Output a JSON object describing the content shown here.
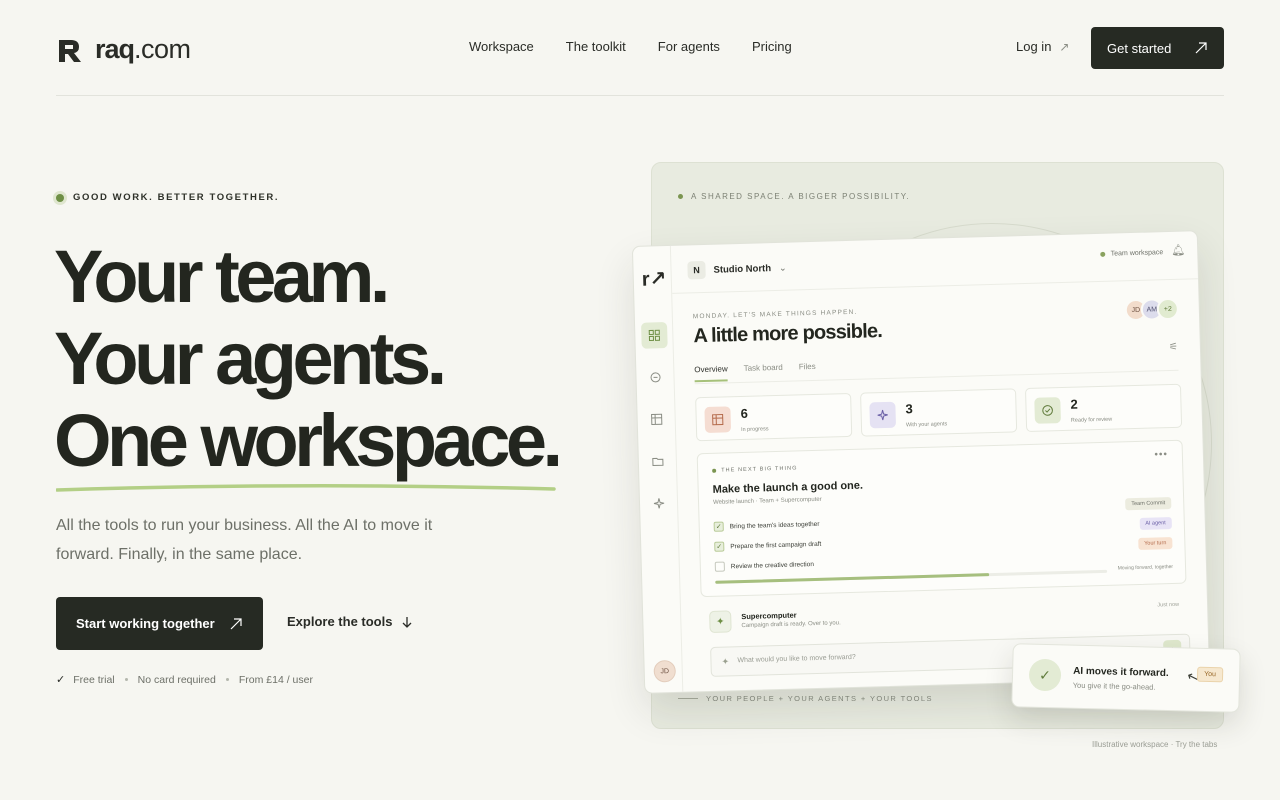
{
  "brand": {
    "name": "raq",
    "tld": ".com"
  },
  "nav": {
    "links": [
      "Workspace",
      "The toolkit",
      "For agents",
      "Pricing"
    ],
    "login": "Log in",
    "cta": "Get started"
  },
  "hero": {
    "eyebrow": "GOOD WORK. BETTER TOGETHER.",
    "headline": [
      "Your team.",
      "Your agents.",
      "One workspace."
    ],
    "subtext": "All the tools to run your business. All the AI to move it forward. Finally, in the same place.",
    "primary_cta": "Start working together",
    "secondary_cta": "Explore the tools",
    "perks": [
      "Free trial",
      "No card required",
      "From £14 / user"
    ]
  },
  "panel": {
    "eyebrow": "A SHARED SPACE. A BIGGER POSSIBILITY.",
    "footer": "YOUR PEOPLE + YOUR AGENTS + YOUR TOOLS",
    "caption": "Illustrative workspace · Try the tabs"
  },
  "app": {
    "logo": "r↗",
    "workspace_initial": "N",
    "workspace_name": "Studio North",
    "team_label": "Team workspace",
    "greeting": "MONDAY. LET'S MAKE THINGS HAPPEN.",
    "title": "A little more possible.",
    "avatars": [
      "JD",
      "AM",
      "+2"
    ],
    "tabs": [
      "Overview",
      "Task board",
      "Files"
    ],
    "stats": [
      {
        "value": "6",
        "label": "In progress",
        "icon": "table-icon"
      },
      {
        "value": "3",
        "label": "With your agents",
        "icon": "sparkle-icon"
      },
      {
        "value": "2",
        "label": "Ready for review",
        "icon": "check-circle-icon"
      }
    ],
    "card": {
      "eyebrow": "THE NEXT BIG THING",
      "title": "Make the launch a good one.",
      "meta": "Website launch   ·   Team + Supercomputer",
      "tasks": [
        {
          "label": "Bring the team's ideas together",
          "done": true,
          "tag": "Team Commit"
        },
        {
          "label": "Prepare the first campaign draft",
          "done": true,
          "tag": "AI agent"
        },
        {
          "label": "Review the creative direction",
          "done": false,
          "tag": "Your turn"
        }
      ],
      "progress": 0.7,
      "progress_label": "Moving forward, together"
    },
    "agent": {
      "name": "Supercomputer",
      "message": "Campaign draft is ready. Over to you.",
      "time": "Just now"
    },
    "prompt_placeholder": "What would you like to move forward?",
    "user_avatar": "JD"
  },
  "toast": {
    "title": "AI moves it forward.",
    "subtitle": "You give it the go-ahead.",
    "badge": "You"
  },
  "colors": {
    "accent_green": "#a6c17a",
    "dark": "#262a23",
    "background": "#f6f6f1"
  }
}
